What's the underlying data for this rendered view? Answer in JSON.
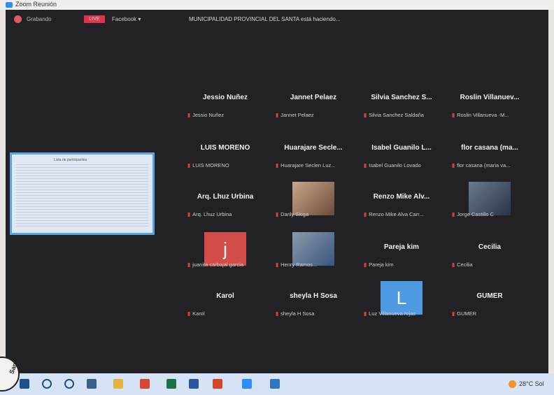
{
  "window_title": "Zoom Reunión",
  "topbar": {
    "recording_label": "Grabando",
    "live_badge": "LIVE",
    "platform": "Facebook ▾",
    "live_message": "MUNICIPALIDAD PROVINCIAL DEL SANTA está haciendo..."
  },
  "shared_screen_title": "Lista de participantes",
  "participants": [
    {
      "display": "Jessio Nuñez",
      "subname": "Jessio Nuñez"
    },
    {
      "display": "Jannet Pelaez",
      "subname": "Jannet Pelaez"
    },
    {
      "display": "Silvia Sanchez S...",
      "subname": "Silvia Sanchez Saldaña"
    },
    {
      "display": "Roslin Villanuev...",
      "subname": "Roslin Villanueva -M..."
    },
    {
      "display": "LUIS MORENO",
      "subname": "LUIS MORENO"
    },
    {
      "display": "Huarajare Secle...",
      "subname": "Huarajare Seclen Luz..."
    },
    {
      "display": "Isabel Guanilo L...",
      "subname": "Isabel Guanilo Lovado"
    },
    {
      "display": "flor casana (ma...",
      "subname": "flor casana (maria va..."
    },
    {
      "display": "Arq. Lhuz Urbina",
      "subname": "Arq. Lhuz Urbina"
    },
    {
      "display": "",
      "subname": "Darily Skiga"
    },
    {
      "display": "Renzo Mike Alv...",
      "subname": "Renzo Mike Alva Carr..."
    },
    {
      "display": "",
      "subname": "Jorge Castillo C"
    },
    {
      "display": "",
      "subname": "juanita carbajal garcia",
      "avatar_letter": "j",
      "avatar_color": "#d24c4a"
    },
    {
      "display": "",
      "subname": "Henry Ramos..."
    },
    {
      "display": "Pareja kim",
      "subname": "Pareja kim"
    },
    {
      "display": "Cecilia",
      "subname": "Cecilia"
    },
    {
      "display": "Karol",
      "subname": "Karol"
    },
    {
      "display": "sheyla H Sosa",
      "subname": "sheyla H Sosa"
    },
    {
      "display": "",
      "subname": "Luz Villanueva rojas",
      "avatar_letter": "L",
      "avatar_color": "#4f9be3"
    },
    {
      "display": "GUMER",
      "subname": "GUMER"
    }
  ],
  "taskbar": {
    "weather": "28°C Sol",
    "apps": [
      "start-icon",
      "search-icon",
      "cortana-icon",
      "task-view-icon",
      "explorer-icon",
      "chrome-icon",
      "excel-icon",
      "word-icon",
      "powerpoint-icon",
      "zoom-icon",
      "edge-icon"
    ]
  },
  "stamp_text": "Santa",
  "colors": {
    "zoom_bg": "#222226",
    "mic_muted": "#e23b3b",
    "live": "#e0344a",
    "taskbar": "#d6e3f5"
  }
}
